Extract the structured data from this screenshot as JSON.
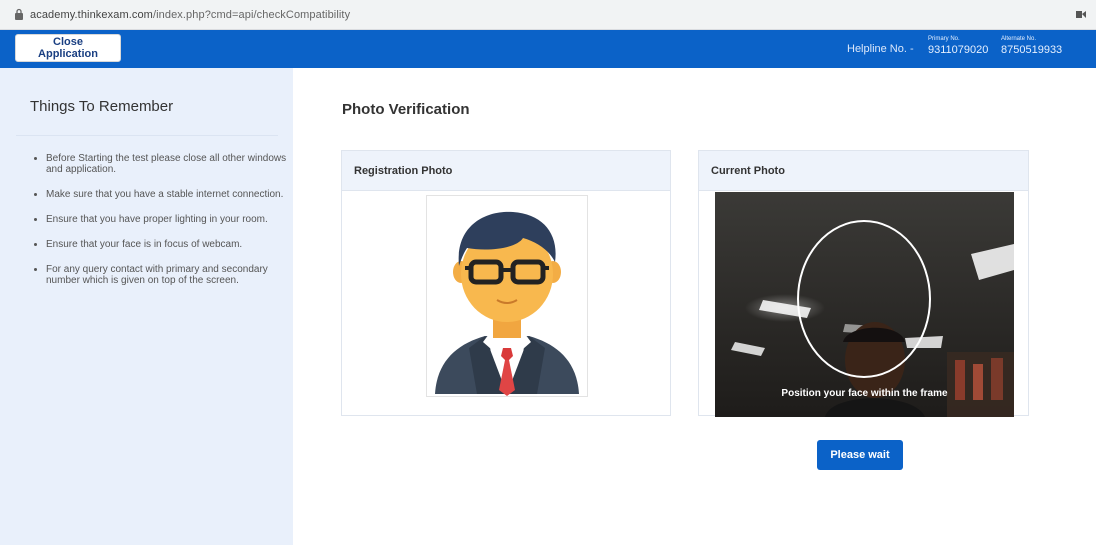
{
  "browser": {
    "url_host": "academy.thinkexam.com",
    "url_path": "/index.php?cmd=api/checkCompatibility"
  },
  "header": {
    "close_label": "Close Application",
    "helpline_label": "Helpline No. -",
    "primary_label": "Primary No.",
    "primary_number": "9311079020",
    "alternate_label": "Alternate No.",
    "alternate_number": "8750519933",
    "colors": {
      "bar": "#0b62c8"
    }
  },
  "sidebar": {
    "title": "Things To Remember",
    "items": [
      "Before Starting the test please close all other windows and application.",
      "Make sure that you have a stable internet connection.",
      "Ensure that you have proper lighting in your room.",
      "Ensure that your face is in focus of webcam.",
      "For any query contact with primary and secondary number which is given on top of the screen."
    ]
  },
  "main": {
    "title": "Photo Verification",
    "registration_title": "Registration Photo",
    "current_title": "Current Photo",
    "camera_message": "Position your face within the frame",
    "wait_label": "Please wait"
  }
}
